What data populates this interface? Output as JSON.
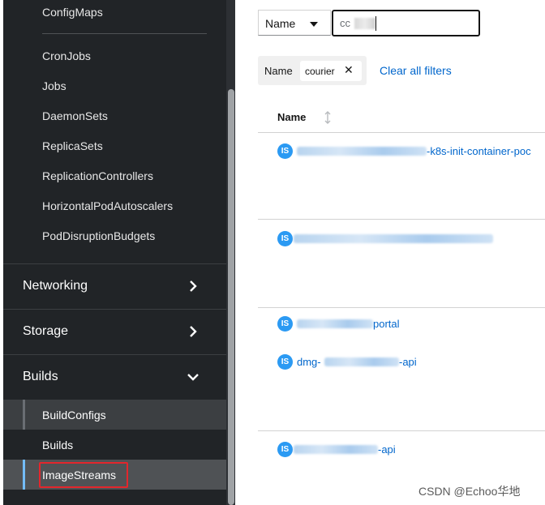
{
  "sidebar": {
    "workloads_items": [
      "ConfigMaps",
      "CronJobs",
      "Jobs",
      "DaemonSets",
      "ReplicaSets",
      "ReplicationControllers",
      "HorizontalPodAutoscalers",
      "PodDisruptionBudgets"
    ],
    "sections": [
      "Networking",
      "Storage",
      "Builds"
    ],
    "builds_items": [
      "BuildConfigs",
      "Builds",
      "ImageStreams"
    ]
  },
  "filter": {
    "category": "Name",
    "search_value": "cc"
  },
  "chips": {
    "category": "Name",
    "chip": "courier",
    "clear_all": "Clear all filters"
  },
  "table": {
    "column": "Name",
    "badge": "IS",
    "rows": [
      {
        "visible_suffix": "-k8s-init-container-poc"
      },
      {
        "visible_suffix": ""
      },
      {
        "visible_suffix": "portal"
      },
      {
        "visible_prefix": "dmg-",
        "visible_suffix": "-api"
      },
      {
        "visible_suffix": "-api"
      }
    ]
  },
  "watermark": "CSDN @Echoo华地",
  "colors": {
    "sidebar_bg": "#212427",
    "link": "#0066cc",
    "badge": "#2b9af3",
    "active_bar": "#73bcf7",
    "highlight_box": "#e3262c"
  }
}
